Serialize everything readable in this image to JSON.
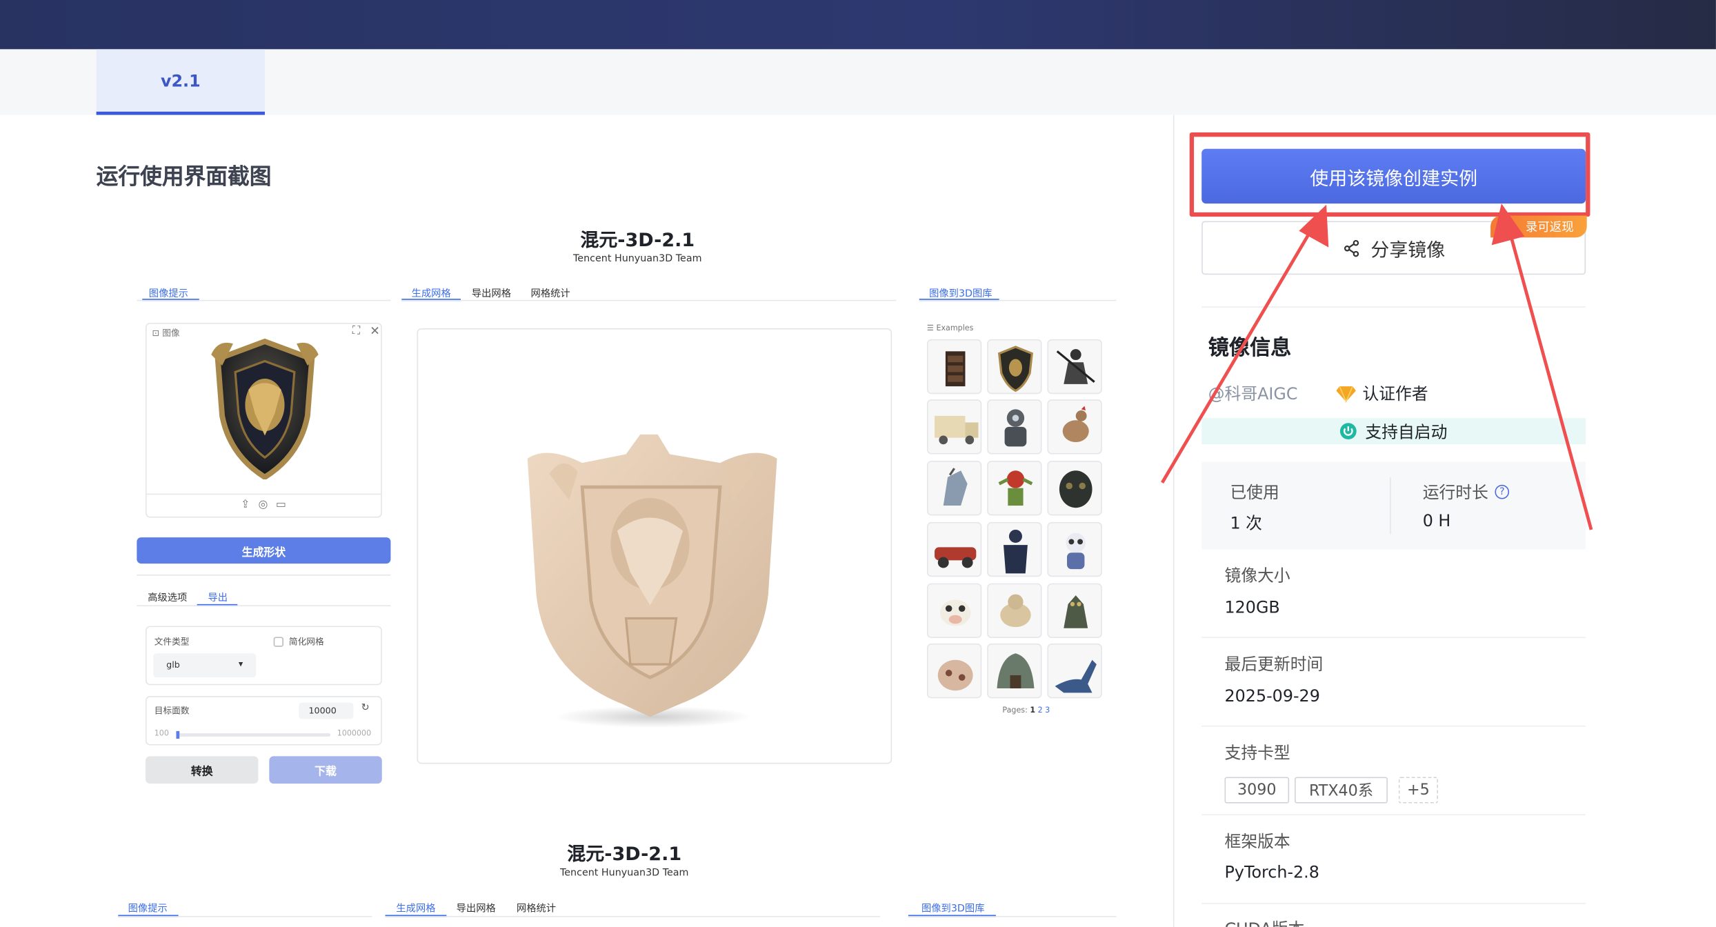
{
  "header": {
    "version_tab": "v2.1"
  },
  "section_title": "运行使用界面截图",
  "screenshot1": {
    "app_title": "混元-3D-2.1",
    "app_subtitle": "Tencent Hunyuan3D Team",
    "left_tab": "图像提示",
    "image_label": "图像",
    "generate_button": "生成形状",
    "option_tabs": [
      "高级选项",
      "导出"
    ],
    "file_type_label": "文件类型",
    "file_type_value": "glb",
    "simplify_label": "简化网格",
    "target_faces_label": "目标面数",
    "target_faces_value": "10000",
    "slider_min": "100",
    "slider_max": "1000000",
    "convert_button": "转换",
    "download_button": "下载",
    "center_tabs": [
      "生成网格",
      "导出网格",
      "网格统计"
    ],
    "right_tab": "图像到3D图库",
    "examples_label": "Examples",
    "pages_label": "Pages:",
    "pages": [
      "1",
      "2",
      "3"
    ]
  },
  "screenshot2": {
    "app_title": "混元-3D-2.1",
    "app_subtitle": "Tencent Hunyuan3D Team",
    "left_tab": "图像提示",
    "center_tabs": [
      "生成网格",
      "导出网格",
      "网格统计"
    ],
    "right_tab": "图像到3D图库"
  },
  "sidebar": {
    "create_button": "使用该镜像创建实例",
    "share_button": "分享镜像",
    "cashback_badge": "录可返现",
    "info_title": "镜像信息",
    "author": "@科哥AIGC",
    "certified": "认证作者",
    "autostart": "支持自启动",
    "used_label": "已使用",
    "used_value": "1 次",
    "runtime_label": "运行时长",
    "runtime_value": "0 H",
    "size_label": "镜像大小",
    "size_value": "120GB",
    "updated_label": "最后更新时间",
    "updated_value": "2025-09-29",
    "gpu_label": "支持卡型",
    "gpu_chips": [
      "3090",
      "RTX40系",
      "+5"
    ],
    "framework_label": "框架版本",
    "framework_value": "PyTorch-2.8",
    "cuda_label": "CUDA版本"
  },
  "colors": {
    "accent": "#4c69e0",
    "highlight_red": "#ec4d4f",
    "topbar": "#283362"
  }
}
